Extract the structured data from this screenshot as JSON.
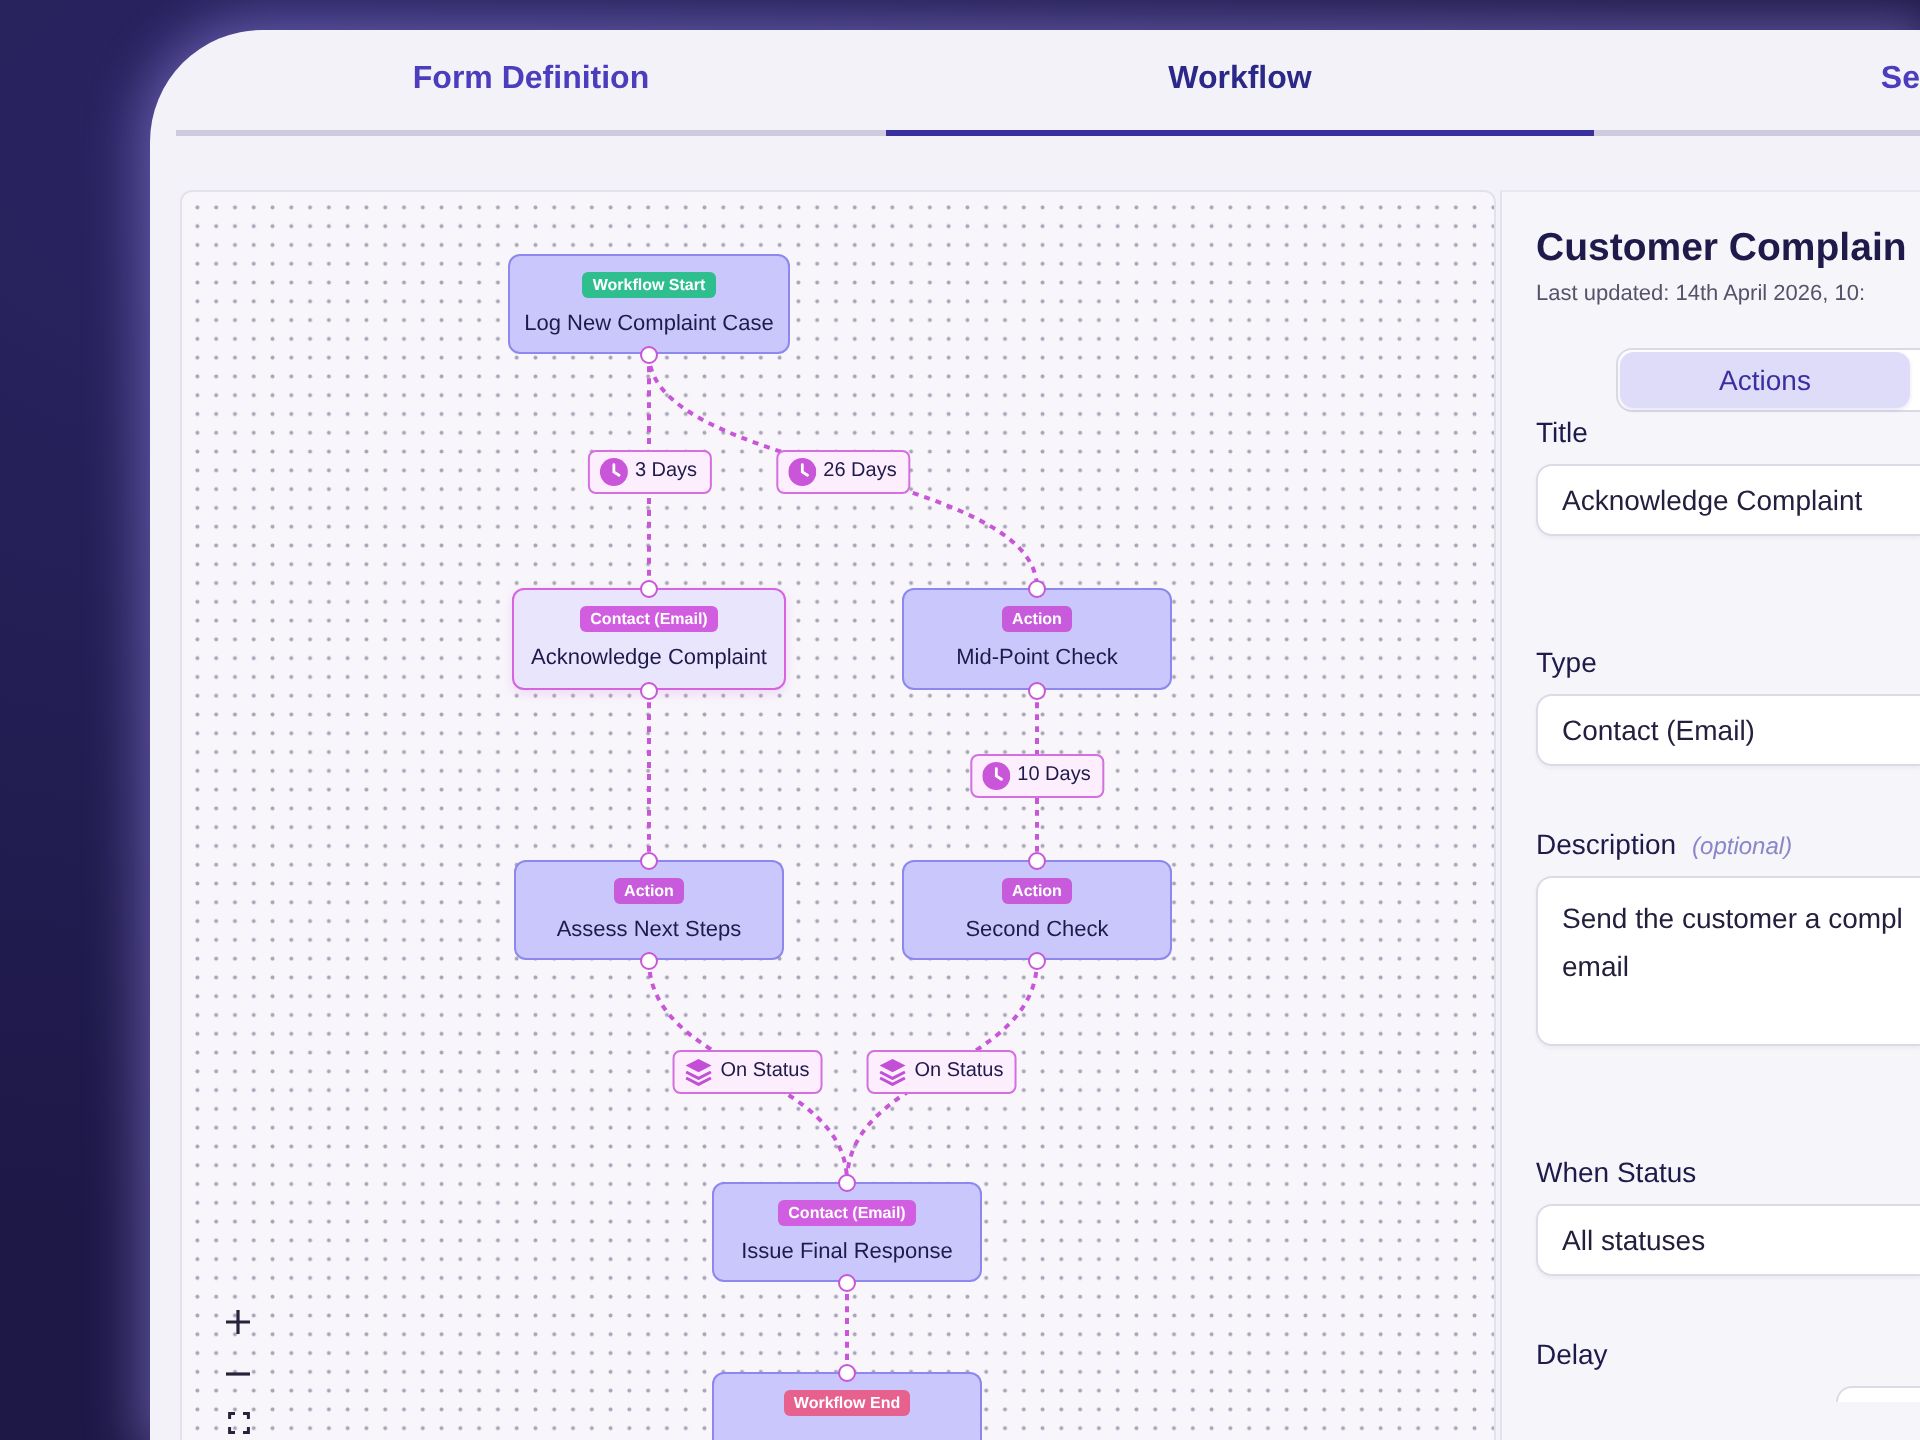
{
  "tabs": [
    {
      "label": "Form Definition",
      "selected": false
    },
    {
      "label": "Workflow",
      "selected": true
    },
    {
      "label": "Se",
      "selected": false
    }
  ],
  "canvas": {
    "nodes": [
      {
        "kind": "start",
        "badge": "Workflow Start",
        "title": "Log New Complaint Case",
        "selected": false
      },
      {
        "kind": "contact",
        "badge": "Contact (Email)",
        "title": "Acknowledge Complaint",
        "selected": true
      },
      {
        "kind": "action",
        "badge": "Action",
        "title": "Mid-Point Check",
        "selected": false
      },
      {
        "kind": "action",
        "badge": "Action",
        "title": "Assess Next Steps",
        "selected": false
      },
      {
        "kind": "action",
        "badge": "Action",
        "title": "Second Check",
        "selected": false
      },
      {
        "kind": "contact",
        "badge": "Contact (Email)",
        "title": "Issue Final Response",
        "selected": false
      },
      {
        "kind": "end",
        "badge": "Workflow End",
        "selected": false
      }
    ],
    "edges": [
      {
        "kind": "delay",
        "label": "3 Days"
      },
      {
        "kind": "delay",
        "label": "26 Days"
      },
      {
        "kind": "delay",
        "label": "10 Days"
      },
      {
        "kind": "plain"
      },
      {
        "kind": "status",
        "label": "On Status"
      },
      {
        "kind": "status",
        "label": "On Status"
      },
      {
        "kind": "plain"
      }
    ]
  },
  "panel": {
    "title": "Customer Complain",
    "subtitle": "Last updated: 14th April 2026, 10:",
    "segments": [
      {
        "label": "Actions",
        "selected": true
      }
    ],
    "fields": [
      {
        "label": "Title",
        "kind": "input",
        "value": "Acknowledge Complaint"
      },
      {
        "label": "Type",
        "kind": "select",
        "value": "Contact (Email)"
      },
      {
        "label": "Description",
        "hint": "(optional)",
        "kind": "textarea",
        "value": "Send the customer a compl\nemail"
      },
      {
        "label": "When Status",
        "kind": "select",
        "value": "All statuses"
      },
      {
        "label": "Delay",
        "kind": "short"
      }
    ]
  }
}
